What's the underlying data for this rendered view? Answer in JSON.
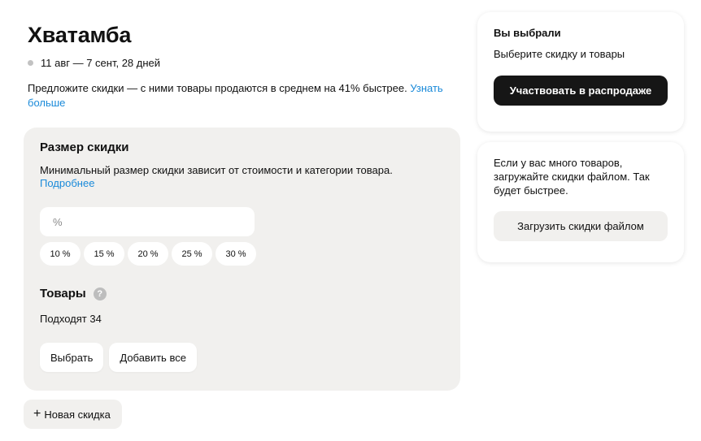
{
  "promo": {
    "title": "Хватамба",
    "dates": "11 авг — 7 сент, 28 дней",
    "intro_text": "Предложите скидки — с ними товары продаются в среднем на 41% быстрее.",
    "intro_link": "Узнать больше"
  },
  "discount_panel": {
    "title": "Размер скидки",
    "description": "Минимальный размер скидки зависит от стоимости и категории товара.",
    "more_link": "Подробнее",
    "input_placeholder": "%",
    "input_value": "",
    "chips": [
      "10 %",
      "15 %",
      "20 %",
      "25 %",
      "30 %"
    ],
    "goods_title": "Товары",
    "help_icon": "?",
    "goods_count": "Подходят 34",
    "select_button": "Выбрать",
    "add_all_button": "Добавить все"
  },
  "new_discount": {
    "icon": "+",
    "label": "Новая скидка"
  },
  "summary_card": {
    "title": "Вы выбрали",
    "subtitle": "Выберите скидку и товары",
    "participate_button": "Участвовать в распродаже"
  },
  "upload_card": {
    "text": "Если у вас много товаров, загружайте скидки файлом. Так будет быстрее.",
    "upload_button": "Загрузить скидки файлом"
  },
  "colors": {
    "accent_link": "#1a8ad9",
    "panel_bg": "#f1f0ee",
    "primary_button": "#161616"
  }
}
